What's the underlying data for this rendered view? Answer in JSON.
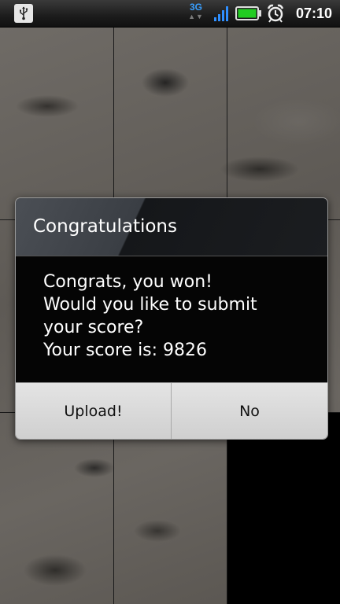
{
  "status_bar": {
    "network_type": "3G",
    "network_arrows": "▲▼",
    "time": "07:10",
    "icons": [
      "usb-icon",
      "3g-icon",
      "signal-icon",
      "battery-icon",
      "alarm-icon"
    ],
    "battery_color": "#22cc22",
    "signal_color": "#2f8fff"
  },
  "dialog": {
    "title": "Congratulations",
    "message_lines": [
      "Congrats, you won!",
      "Would you like to submit",
      "your score?",
      "Your score is: 9826"
    ],
    "buttons": {
      "upload": "Upload!",
      "no": "No"
    }
  }
}
